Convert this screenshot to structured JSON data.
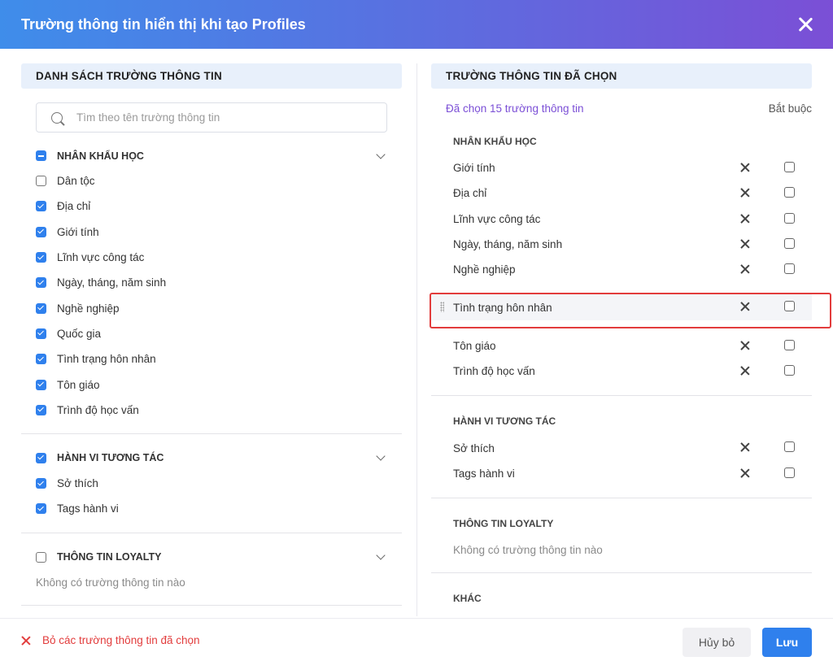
{
  "header": {
    "title": "Trường thông tin hiển thị khi tạo Profiles"
  },
  "left": {
    "title": "DANH SÁCH TRƯỜNG THÔNG TIN",
    "search_placeholder": "Tìm theo tên trường thông tin",
    "groups": [
      {
        "label": "NHÂN KHẨU HỌC",
        "state": "partial",
        "items": [
          {
            "label": "Dân tộc",
            "checked": false
          },
          {
            "label": "Địa chỉ",
            "checked": true
          },
          {
            "label": "Giới tính",
            "checked": true
          },
          {
            "label": "Lĩnh vực công tác",
            "checked": true
          },
          {
            "label": "Ngày, tháng, năm sinh",
            "checked": true
          },
          {
            "label": "Nghề nghiệp",
            "checked": true
          },
          {
            "label": "Quốc gia",
            "checked": true
          },
          {
            "label": "Tình trạng hôn nhân",
            "checked": true
          },
          {
            "label": "Tôn giáo",
            "checked": true
          },
          {
            "label": "Trình độ học vấn",
            "checked": true
          }
        ]
      },
      {
        "label": "HÀNH VI TƯƠNG TÁC",
        "state": "checked",
        "items": [
          {
            "label": "Sở thích",
            "checked": true
          },
          {
            "label": "Tags hành vi",
            "checked": true
          }
        ]
      },
      {
        "label": "THÔNG TIN LOYALTY",
        "state": "unchecked",
        "empty_text": "Không có trường thông tin nào"
      }
    ]
  },
  "right": {
    "title": "TRƯỜNG THÔNG TIN ĐÃ CHỌN",
    "selected_count": "Đã chọn 15 trường thông tin",
    "required_label": "Bắt buộc",
    "groups": [
      {
        "label": "NHÂN KHẨU HỌC",
        "items": [
          "Giới tính",
          "Địa chỉ",
          "Lĩnh vực công tác",
          "Ngày, tháng, năm sinh",
          "Nghề nghiệp",
          "Tình trạng hôn nhân",
          "Tôn giáo",
          "Trình độ học vấn"
        ]
      },
      {
        "label": "HÀNH VI TƯƠNG TÁC",
        "items": [
          "Sở thích",
          "Tags hành vi"
        ]
      },
      {
        "label": "THÔNG TIN LOYALTY",
        "empty_text": "Không có trường thông tin nào"
      },
      {
        "label": "KHÁC"
      }
    ]
  },
  "footer": {
    "clear_label": "Bỏ các trường thông tin đã chọn",
    "cancel_label": "Hủy bỏ",
    "save_label": "Lưu"
  },
  "colors": {
    "accent": "#2f80ed",
    "danger": "#e23c3c",
    "count": "#7b4fd6"
  }
}
